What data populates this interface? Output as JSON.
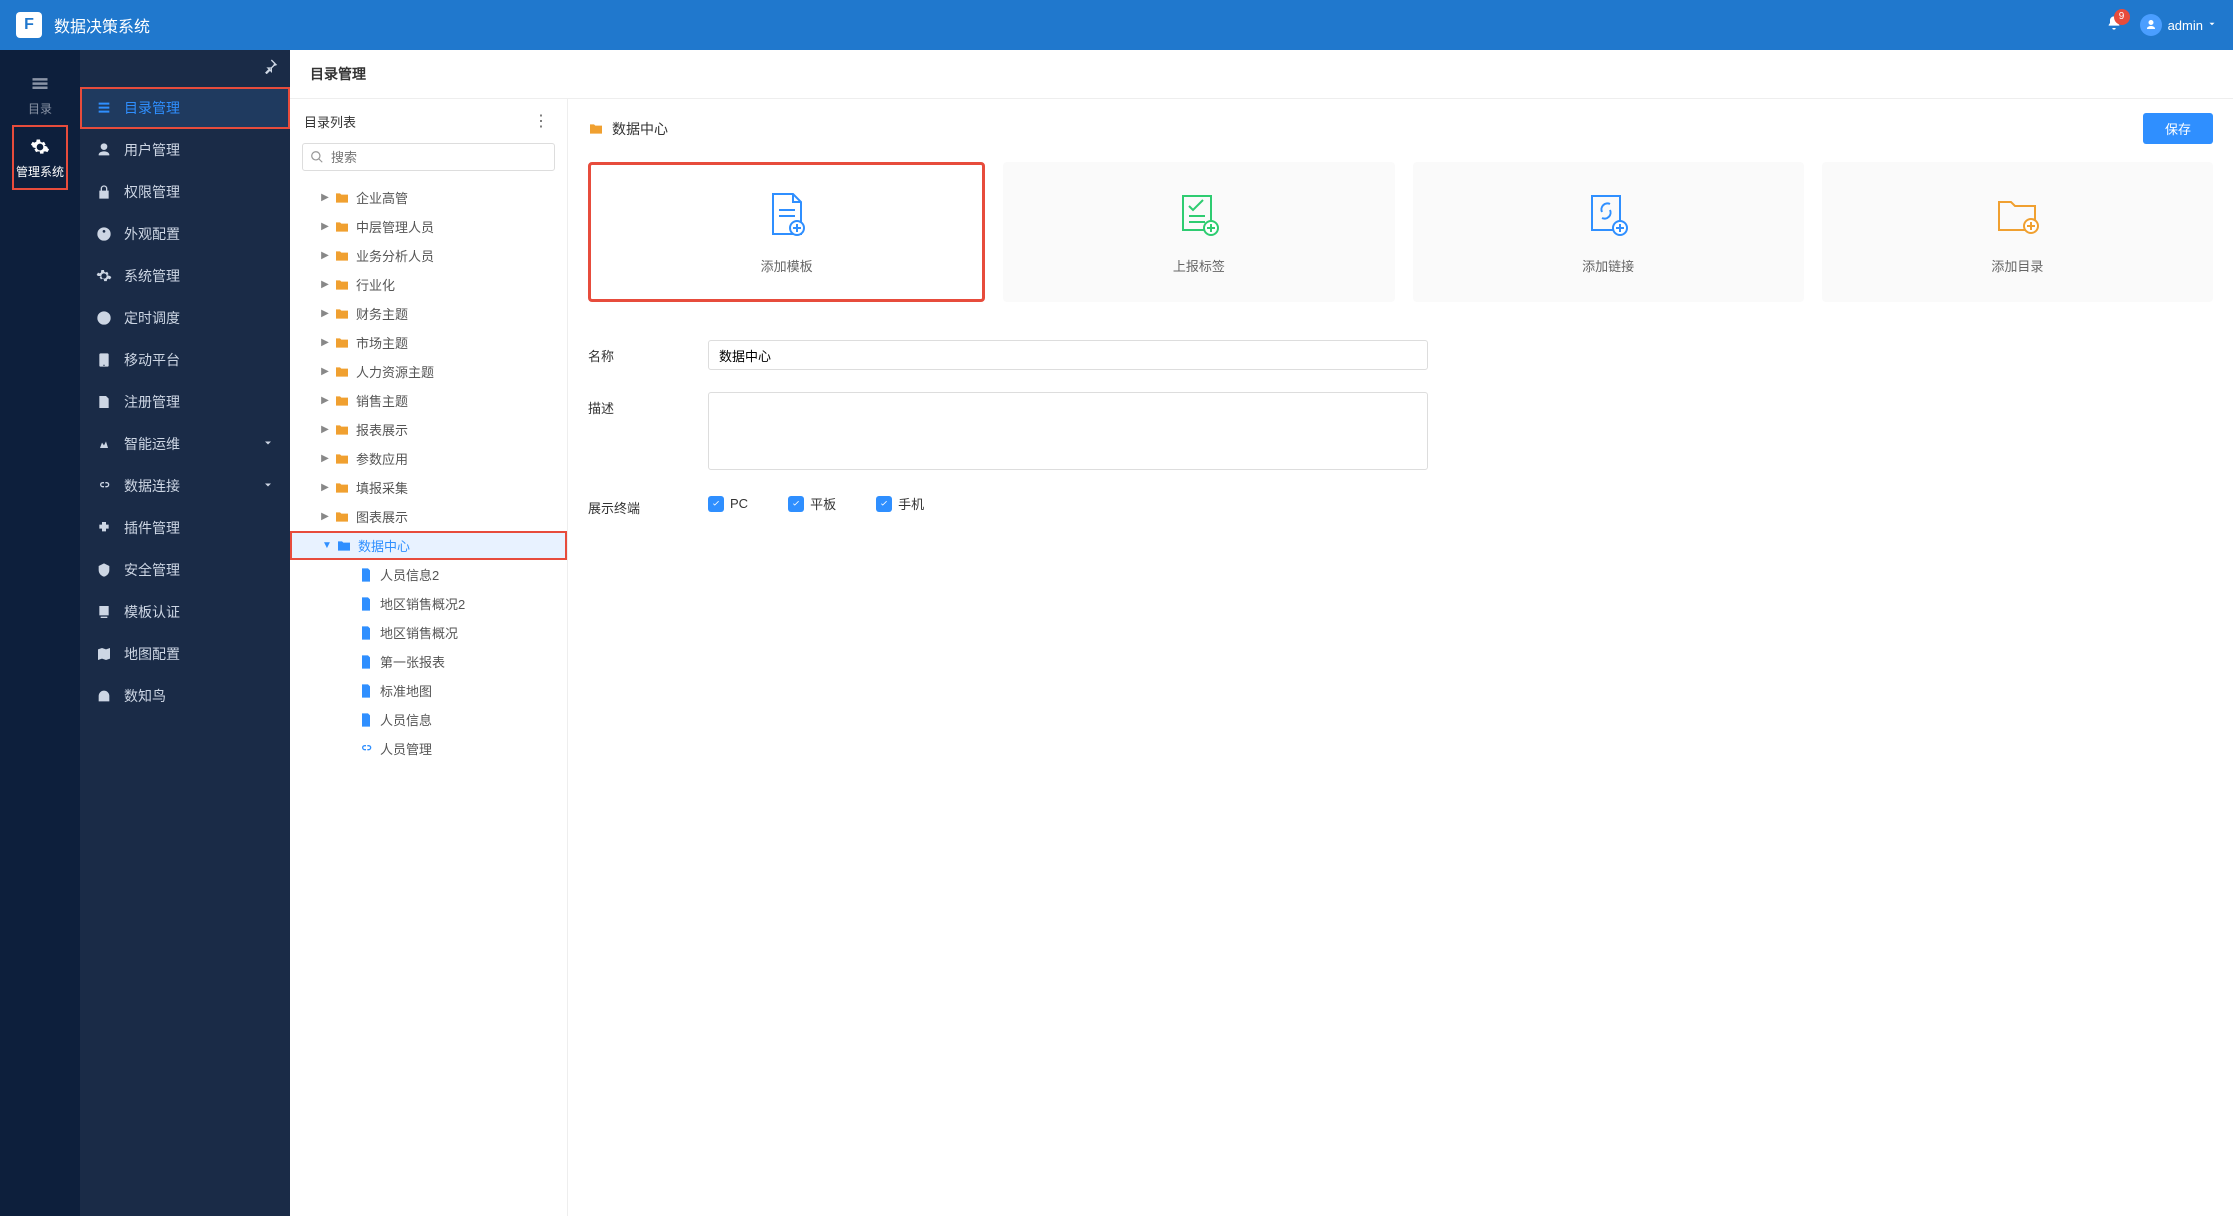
{
  "header": {
    "app_title": "数据决策系统",
    "notification_count": "9",
    "username": "admin"
  },
  "rail": {
    "items": [
      {
        "id": "directory",
        "label": "目录"
      },
      {
        "id": "system",
        "label": "管理系统"
      }
    ]
  },
  "sidebar": {
    "items": [
      {
        "id": "catalog",
        "label": "目录管理",
        "active": true
      },
      {
        "id": "user",
        "label": "用户管理"
      },
      {
        "id": "perm",
        "label": "权限管理"
      },
      {
        "id": "appearance",
        "label": "外观配置"
      },
      {
        "id": "sysmgr",
        "label": "系统管理"
      },
      {
        "id": "schedule",
        "label": "定时调度"
      },
      {
        "id": "mobile",
        "label": "移动平台"
      },
      {
        "id": "register",
        "label": "注册管理"
      },
      {
        "id": "aiops",
        "label": "智能运维",
        "expandable": true
      },
      {
        "id": "dataconn",
        "label": "数据连接",
        "expandable": true
      },
      {
        "id": "plugin",
        "label": "插件管理"
      },
      {
        "id": "security",
        "label": "安全管理"
      },
      {
        "id": "tplcert",
        "label": "模板认证"
      },
      {
        "id": "mapcfg",
        "label": "地图配置"
      },
      {
        "id": "shuzhiniao",
        "label": "数知鸟"
      }
    ]
  },
  "content": {
    "page_title": "目录管理",
    "tree": {
      "title": "目录列表",
      "search_placeholder": "搜索",
      "nodes": [
        {
          "type": "folder",
          "label": "企业高管"
        },
        {
          "type": "folder",
          "label": "中层管理人员"
        },
        {
          "type": "folder",
          "label": "业务分析人员"
        },
        {
          "type": "folder",
          "label": "行业化"
        },
        {
          "type": "folder",
          "label": "财务主题"
        },
        {
          "type": "folder",
          "label": "市场主题"
        },
        {
          "type": "folder",
          "label": "人力资源主题"
        },
        {
          "type": "folder",
          "label": "销售主题"
        },
        {
          "type": "folder",
          "label": "报表展示"
        },
        {
          "type": "folder",
          "label": "参数应用"
        },
        {
          "type": "folder",
          "label": "填报采集"
        },
        {
          "type": "folder",
          "label": "图表展示"
        },
        {
          "type": "folder",
          "label": "数据中心",
          "selected": true,
          "expanded": true,
          "children": [
            {
              "type": "file",
              "label": "人员信息2"
            },
            {
              "type": "file",
              "label": "地区销售概况2"
            },
            {
              "type": "file",
              "label": "地区销售概况"
            },
            {
              "type": "file",
              "label": "第一张报表"
            },
            {
              "type": "file",
              "label": "标准地图"
            },
            {
              "type": "file",
              "label": "人员信息"
            },
            {
              "type": "link",
              "label": "人员管理"
            }
          ]
        }
      ]
    },
    "detail": {
      "breadcrumb": "数据中心",
      "save_label": "保存",
      "cards": [
        {
          "id": "add-template",
          "label": "添加模板",
          "highlight": true,
          "color": "#2f8fff"
        },
        {
          "id": "report-tag",
          "label": "上报标签",
          "highlight": false,
          "color": "#2ecc71"
        },
        {
          "id": "add-link",
          "label": "添加链接",
          "highlight": false,
          "color": "#2f8fff"
        },
        {
          "id": "add-dir",
          "label": "添加目录",
          "highlight": false,
          "color": "#f0a030"
        }
      ],
      "form": {
        "name_label": "名称",
        "name_value": "数据中心",
        "desc_label": "描述",
        "desc_value": "",
        "terminal_label": "展示终端",
        "terminals": [
          {
            "id": "pc",
            "label": "PC",
            "checked": true
          },
          {
            "id": "tablet",
            "label": "平板",
            "checked": true
          },
          {
            "id": "phone",
            "label": "手机",
            "checked": true
          }
        ]
      }
    }
  }
}
